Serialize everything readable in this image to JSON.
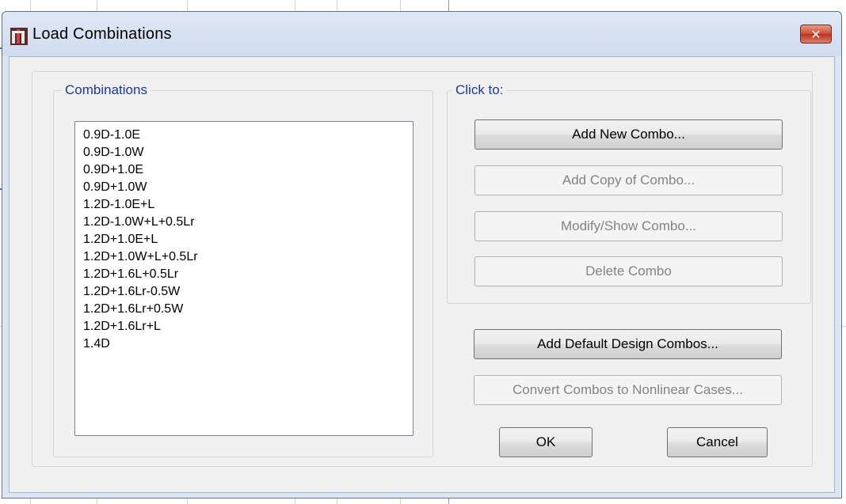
{
  "window": {
    "title": "Load Combinations",
    "close_glyph": "✕"
  },
  "combinations": {
    "legend": "Combinations",
    "items": [
      "0.9D-1.0E",
      "0.9D-1.0W",
      "0.9D+1.0E",
      "0.9D+1.0W",
      "1.2D-1.0E+L",
      "1.2D-1.0W+L+0.5Lr",
      "1.2D+1.0E+L",
      "1.2D+1.0W+L+0.5Lr",
      "1.2D+1.6L+0.5Lr",
      "1.2D+1.6Lr-0.5W",
      "1.2D+1.6Lr+0.5W",
      "1.2D+1.6Lr+L",
      "1.4D"
    ]
  },
  "click_to": {
    "legend": "Click to:",
    "add_new": "Add New Combo...",
    "add_copy": "Add Copy of Combo...",
    "modify_show": "Modify/Show Combo...",
    "delete": "Delete Combo"
  },
  "actions": {
    "add_default": "Add Default Design Combos...",
    "convert": "Convert Combos to Nonlinear Cases...",
    "ok": "OK",
    "cancel": "Cancel"
  },
  "icons": {
    "app": "sap2000-app-icon",
    "close": "close-icon"
  },
  "colors": {
    "legend_text": "#1b3a94",
    "close_button": "#cc4a33",
    "disabled_text": "#838383"
  }
}
